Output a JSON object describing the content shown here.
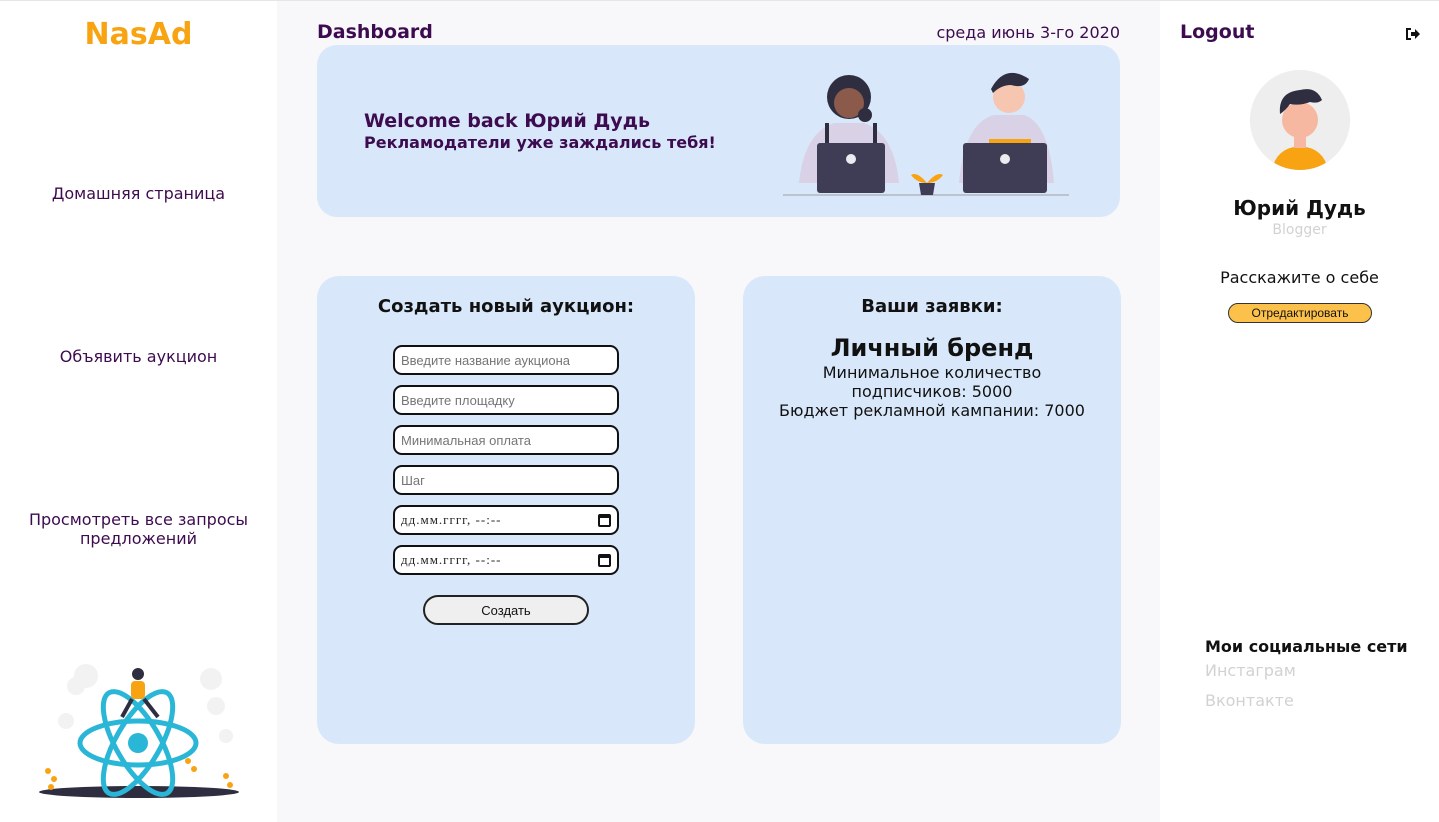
{
  "brand": {
    "logo": "NasAd",
    "color": "#f8a412"
  },
  "sidebar": {
    "items": [
      {
        "label": "Домашняя страница"
      },
      {
        "label": "Объявить аукцион"
      },
      {
        "label": "Просмотреть все запросы предложений"
      }
    ]
  },
  "header": {
    "title": "Dashboard",
    "date": "среда июнь 3-го 2020"
  },
  "welcome": {
    "title": "Welcome back Юрий Дудь",
    "subtitle": "Рекламодатели уже заждались тебя!"
  },
  "create_auction": {
    "title": "Создать новый аукцион:",
    "fields": {
      "name_placeholder": "Введите название аукциона",
      "platform_placeholder": "Введите площадку",
      "min_payment_placeholder": "Минимальная оплата",
      "step_placeholder": "Шаг",
      "start_datetime": "дд.мм.гггг, --:--",
      "end_datetime": "дд.мм.гггг, --:--"
    },
    "submit_label": "Создать"
  },
  "bids": {
    "title": "Ваши заявки:",
    "item": {
      "name": "Личный бренд",
      "min_subscribers_line1": "Минимальное количество",
      "min_subscribers_line2": "подписчиков: 5000",
      "budget": "Бюджет рекламной кампании: 7000"
    }
  },
  "profile": {
    "logout": "Logout",
    "name": "Юрий Дудь",
    "role": "Blogger",
    "about": "Расскажите о себе",
    "edit_label": "Отредактировать"
  },
  "socials": {
    "title": "Мои социальные сети",
    "links": [
      {
        "label": "Инстаграм"
      },
      {
        "label": "Вконтакте"
      }
    ]
  },
  "colors": {
    "primary_text": "#3d0b4f",
    "card_bg": "#d8e8fa",
    "accent": "#f8a412",
    "edit_button": "#fcc14b"
  }
}
